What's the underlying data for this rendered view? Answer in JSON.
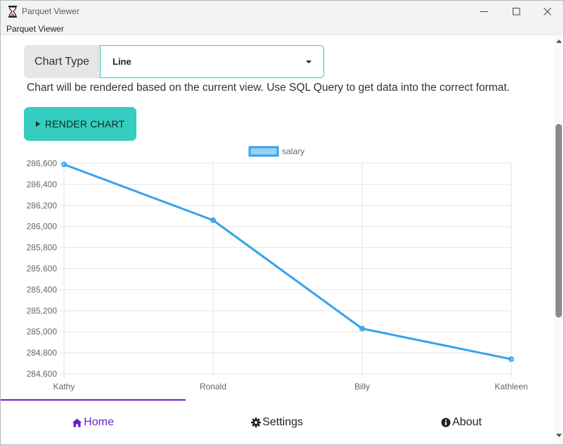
{
  "window": {
    "title": "Parquet Viewer",
    "menu_label": "Parquet Viewer"
  },
  "controls": {
    "chart_type_label": "Chart Type",
    "chart_type_value": "Line",
    "hint": "Chart will be rendered based on the current view. Use SQL Query to get data into the correct format.",
    "render_label": "RENDER CHART"
  },
  "chart_data": {
    "type": "line",
    "categories": [
      "Kathy",
      "Ronald",
      "Billy",
      "Kathleen"
    ],
    "series": [
      {
        "name": "salary",
        "values": [
          286590,
          286060,
          285030,
          284740
        ]
      }
    ],
    "ylim": [
      284600,
      286600
    ],
    "yticks": [
      "286,600",
      "286,400",
      "286,200",
      "286,000",
      "285,800",
      "285,600",
      "285,400",
      "285,200",
      "285,000",
      "284,800",
      "284,600"
    ],
    "grid": true,
    "legend": "top-center",
    "color": "#36a2eb"
  },
  "tabs": [
    {
      "label": "Home",
      "icon": "home-icon",
      "active": true
    },
    {
      "label": "Settings",
      "icon": "gear-icon",
      "active": false
    },
    {
      "label": "About",
      "icon": "info-icon",
      "active": false
    }
  ],
  "colors": {
    "accent": "#35cdbf",
    "tab_active": "#6a1fd1"
  }
}
